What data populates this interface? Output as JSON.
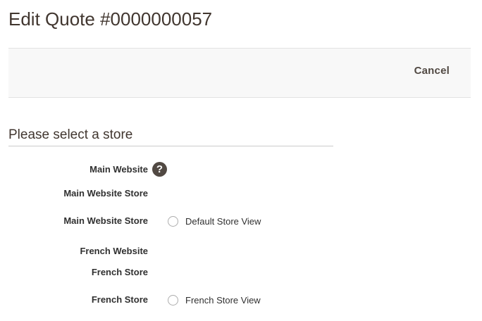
{
  "page": {
    "title": "Edit Quote #0000000057"
  },
  "actions": {
    "cancel_label": "Cancel"
  },
  "store_selection": {
    "heading": "Please select a store",
    "help_icon_glyph": "?",
    "websites": [
      {
        "website_label": "Main Website",
        "store_group_label": "Main Website Store",
        "store_label": "Main Website Store",
        "store_view_label": "Default Store View"
      },
      {
        "website_label": "French Website",
        "store_group_label": "French Store",
        "store_label": "French Store",
        "store_view_label": "French Store View"
      }
    ]
  },
  "icons": {
    "help": "question-mark-icon"
  },
  "colors": {
    "title": "#41362f",
    "action_bar_bg": "#f8f8f8",
    "help_icon_bg": "#514943"
  }
}
